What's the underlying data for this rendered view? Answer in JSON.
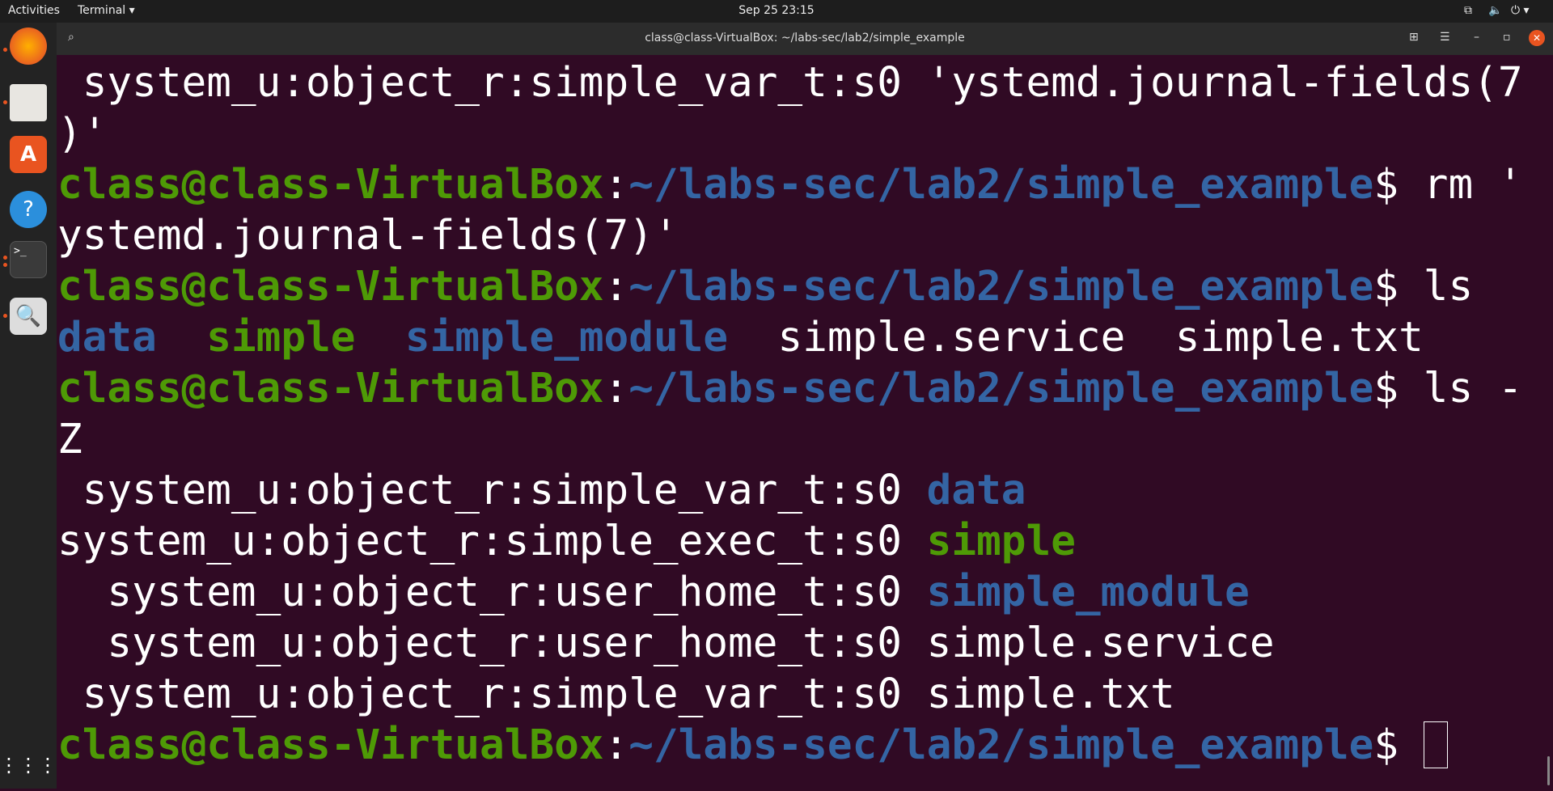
{
  "topbar": {
    "activities": "Activities",
    "app_menu": "Terminal ▾",
    "clock": "Sep 25  23:15",
    "status_icons": [
      "network-icon",
      "volume-icon",
      "power-icon"
    ]
  },
  "dock": {
    "items": [
      "firefox-icon",
      "files-icon",
      "software-center-icon",
      "help-icon",
      "terminal-icon",
      "screenshot-icon",
      "app-grid-icon"
    ]
  },
  "window": {
    "title": "class@class-VirtualBox: ~/labs-sec/lab2/simple_example"
  },
  "colors": {
    "background": "#300a24",
    "prompt_user": "#4e9a06",
    "prompt_path": "#3465a4",
    "text": "#ffffff"
  },
  "terminal": {
    "lines": [
      [
        {
          "t": " system_u:object_r:simple_var_t:s0 'ystemd.journal-fields(7",
          "c": "#ffffff"
        }
      ],
      [
        {
          "t": ")'",
          "c": "#ffffff"
        }
      ],
      [
        {
          "t": "class@class-VirtualBox",
          "c": "#4e9a06",
          "b": true
        },
        {
          "t": ":",
          "c": "#ffffff"
        },
        {
          "t": "~/labs-sec/lab2/simple_example",
          "c": "#3465a4",
          "b": true
        },
        {
          "t": "$ rm '",
          "c": "#ffffff"
        }
      ],
      [
        {
          "t": "ystemd.journal-fields(7)'",
          "c": "#ffffff"
        }
      ],
      [
        {
          "t": "class@class-VirtualBox",
          "c": "#4e9a06",
          "b": true
        },
        {
          "t": ":",
          "c": "#ffffff"
        },
        {
          "t": "~/labs-sec/lab2/simple_example",
          "c": "#3465a4",
          "b": true
        },
        {
          "t": "$ ls",
          "c": "#ffffff"
        }
      ],
      [
        {
          "t": "data",
          "c": "#3465a4",
          "b": true
        },
        {
          "t": "  ",
          "c": "#ffffff"
        },
        {
          "t": "simple",
          "c": "#4e9a06",
          "b": true
        },
        {
          "t": "  ",
          "c": "#ffffff"
        },
        {
          "t": "simple_module",
          "c": "#3465a4",
          "b": true
        },
        {
          "t": "  simple.service  simple.txt",
          "c": "#ffffff"
        }
      ],
      [
        {
          "t": "class@class-VirtualBox",
          "c": "#4e9a06",
          "b": true
        },
        {
          "t": ":",
          "c": "#ffffff"
        },
        {
          "t": "~/labs-sec/lab2/simple_example",
          "c": "#3465a4",
          "b": true
        },
        {
          "t": "$ ls -",
          "c": "#ffffff"
        }
      ],
      [
        {
          "t": "Z",
          "c": "#ffffff"
        }
      ],
      [
        {
          "t": " system_u:object_r:simple_var_t:s0 ",
          "c": "#ffffff"
        },
        {
          "t": "data",
          "c": "#3465a4",
          "b": true
        }
      ],
      [
        {
          "t": "system_u:object_r:simple_exec_t:s0 ",
          "c": "#ffffff"
        },
        {
          "t": "simple",
          "c": "#4e9a06",
          "b": true
        }
      ],
      [
        {
          "t": "  system_u:object_r:user_home_t:s0 ",
          "c": "#ffffff"
        },
        {
          "t": "simple_module",
          "c": "#3465a4",
          "b": true
        }
      ],
      [
        {
          "t": "  system_u:object_r:user_home_t:s0 simple.service",
          "c": "#ffffff"
        }
      ],
      [
        {
          "t": " system_u:object_r:simple_var_t:s0 simple.txt",
          "c": "#ffffff"
        }
      ],
      [
        {
          "t": "class@class-VirtualBox",
          "c": "#4e9a06",
          "b": true
        },
        {
          "t": ":",
          "c": "#ffffff"
        },
        {
          "t": "~/labs-sec/lab2/simple_example",
          "c": "#3465a4",
          "b": true
        },
        {
          "t": "$ ",
          "c": "#ffffff"
        }
      ]
    ]
  }
}
